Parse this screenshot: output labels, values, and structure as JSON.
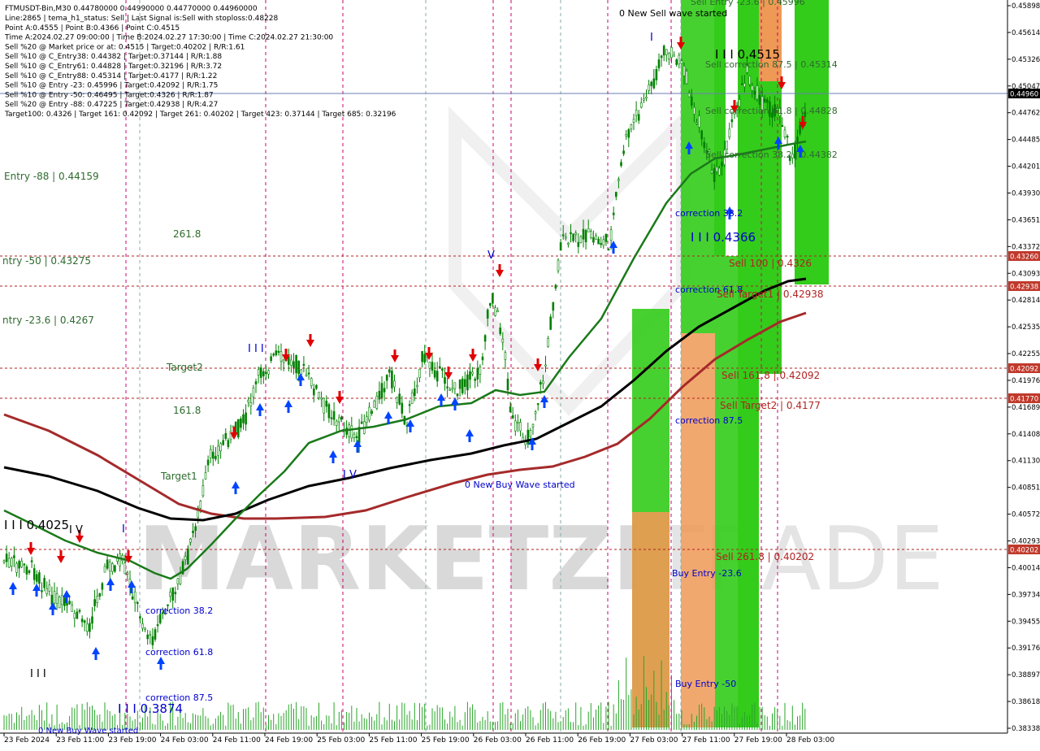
{
  "header": {
    "symbol_line": "FTMUSDT-Bin,M30  0.44780000 0.44990000 0.44770000 0.44960000",
    "info_lines": [
      "Line:2865  |  tema_h1_status: Sell  |  Last Signal is:Sell with stoploss:0.48228",
      "Point A:0.4555  |  Point B:0.4366  |  Point C:0.4515",
      "Time A:2024.02.27 09:00:00  |  Time B:2024.02.27 17:30:00  |  Time C:2024.02.27 21:30:00",
      "Sell %20 @ Market price or at: 0.4515  |  Target:0.40202  |  R/R:1.61",
      "Sell %10 @ C_Entry38: 0.44382  |  Target:0.37144  |  R/R:1.88",
      "Sell %10 @ C_Entry61: 0.44828  |  Target:0.32196  |  R/R:3.72",
      "Sell %10 @ C_Entry88: 0.45314  |  Target:0.4177  |  R/R:1.22",
      "Sell %10 @ Entry -23: 0.45996  |  Target:0.42092  |  R/R:1.75",
      "Sell %10 @ Entry -50: 0.46495  |  Target:0.4326  |  R/R:1.87",
      "Sell %20 @ Entry -88: 0.47225  |  Target:0.42938  |  R/R:4.27",
      "Target100: 0.4326  |  Target 161: 0.42092  |  Target 261: 0.40202  |  Target 423: 0.37144  |  Target 685: 0.32196"
    ]
  },
  "price_axis": {
    "labels": [
      "0.45898",
      "0.45614",
      "0.45326",
      "0.45047",
      "0.44762",
      "0.44485",
      "0.44201",
      "0.43930",
      "0.43651",
      "0.43372",
      "0.43093",
      "0.42814",
      "0.42535",
      "0.42255",
      "0.41976",
      "0.41689",
      "0.41408",
      "0.41130",
      "0.40851",
      "0.40572",
      "0.40293",
      "0.40014",
      "0.39734",
      "0.39455",
      "0.39176",
      "0.38897",
      "0.38618",
      "0.38338"
    ],
    "current_price": "0.44960",
    "tags": [
      {
        "label": "0.43260",
        "color": "#c0392b"
      },
      {
        "label": "0.42938",
        "color": "#c0392b"
      },
      {
        "label": "0.42092",
        "color": "#c0392b"
      },
      {
        "label": "0.41770",
        "color": "#c0392b"
      },
      {
        "label": "0.40202",
        "color": "#c0392b"
      }
    ]
  },
  "time_axis": {
    "labels": [
      "23 Feb 2024",
      "23 Feb 11:00",
      "23 Feb 19:00",
      "24 Feb 03:00",
      "24 Feb 11:00",
      "24 Feb 19:00",
      "25 Feb 03:00",
      "25 Feb 11:00",
      "25 Feb 19:00",
      "26 Feb 03:00",
      "26 Feb 11:00",
      "26 Feb 19:00",
      "27 Feb 03:00",
      "27 Feb 11:00",
      "27 Feb 19:00",
      "28 Feb 03:00"
    ]
  },
  "annotations": {
    "entry_88": "Entry -88 | 0.44159",
    "entry_50": "ntry -50 | 0.43275",
    "entry_23": "ntry -23.6 | 0.4267",
    "lvl_261": "261.8",
    "lvl_161": "161.8",
    "target2": "Target2",
    "target1": "Target1",
    "new_sell_wave": "0 New Sell wave started",
    "new_buy_wave": "0 New Buy Wave started",
    "sell_entry_top": "Sell Entry -23.6 | 0.45996",
    "point_c": "I I I 0.4515",
    "point_b": "I I I 0.4366",
    "point_left": "I I I 0.4025",
    "point_low": "I I I 0.3874",
    "sell_corr_875": "Sell correction 87.5 | 0.45314",
    "sell_corr_618": "Sell correction 61.8 | 0.44828",
    "sell_corr_382": "Sell correction 38.2 | 0.44382",
    "correction_382": "correction 38.2",
    "correction_618": "correction 61.8",
    "correction_875": "correction 87.5",
    "sell_100": "Sell 100 | 0.4326",
    "sell_target1": "Sell Target1 | 0.42938",
    "sell_1618": "Sell 161.8 | 0.42092",
    "sell_target2": "Sell Target2 | 0.4177",
    "sell_2618": "Sell 261.8 | 0.40202",
    "buy_entry_23": "Buy Entry -23.6",
    "buy_entry_50": "Buy Entry -50",
    "wave_III": "I I I",
    "wave_IV_left": "I V",
    "wave_IV_mid": "I V",
    "wave_V": "V",
    "wave_I": "I",
    "wave_I_left": "I",
    "left_low_III": "I I I",
    "new_buy_left": "0 New Buy Wave started",
    "corr_left_382": "correction 38.2",
    "corr_left_618": "correction 61.8",
    "corr_left_875": "correction 87.5"
  },
  "watermark": {
    "text_left": "MARKETZI",
    "text_right": "TRADE"
  },
  "colors": {
    "bg": "#ffffff",
    "candle": "#008000",
    "ma_green": "#1a7a1a",
    "ma_black": "#000000",
    "ma_red": "#a52a2a",
    "sell_arrow": "#e00000",
    "buy_arrow": "#0044ff",
    "zone_green": "#33cc1a",
    "zone_orange": "#ee9955",
    "level_line": "#b22222",
    "time_marker": "#cc0077"
  }
}
